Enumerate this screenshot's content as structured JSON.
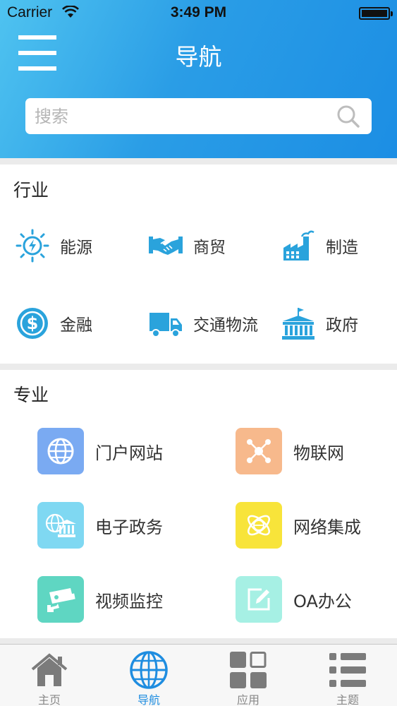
{
  "status_bar": {
    "carrier": "Carrier",
    "time": "3:49 PM"
  },
  "header": {
    "title": "导航",
    "search_placeholder": "搜索"
  },
  "industry": {
    "title": "行业",
    "items": [
      {
        "label": "能源",
        "icon": "energy-icon"
      },
      {
        "label": "商贸",
        "icon": "handshake-icon"
      },
      {
        "label": "制造",
        "icon": "factory-icon"
      },
      {
        "label": "金融",
        "icon": "dollar-coin-icon"
      },
      {
        "label": "交通物流",
        "icon": "truck-icon"
      },
      {
        "label": "政府",
        "icon": "government-building-icon"
      }
    ]
  },
  "professional": {
    "title": "专业",
    "items": [
      {
        "label": "门户网站",
        "icon": "globe-icon",
        "color": "#7aaaf2"
      },
      {
        "label": "物联网",
        "icon": "network-icon",
        "color": "#f7b98c"
      },
      {
        "label": "电子政务",
        "icon": "bank-icon",
        "color": "#7fd8f2"
      },
      {
        "label": "网络集成",
        "icon": "integration-icon",
        "color": "#f8e43a"
      },
      {
        "label": "视频监控",
        "icon": "camera-icon",
        "color": "#5fd6c2"
      },
      {
        "label": "OA办公",
        "icon": "edit-icon",
        "color": "#a6f0e4"
      }
    ]
  },
  "tabbar": {
    "tabs": [
      {
        "label": "主页",
        "icon": "home-icon"
      },
      {
        "label": "导航",
        "icon": "globe-icon",
        "active": true
      },
      {
        "label": "应用",
        "icon": "apps-grid-icon"
      },
      {
        "label": "主题",
        "icon": "list-icon"
      }
    ]
  },
  "colors": {
    "header_gradient_start": "#4fc3f0",
    "header_gradient_end": "#1c8ee4",
    "accent": "#1f8de0",
    "icon_blue": "#2aa3dc"
  }
}
